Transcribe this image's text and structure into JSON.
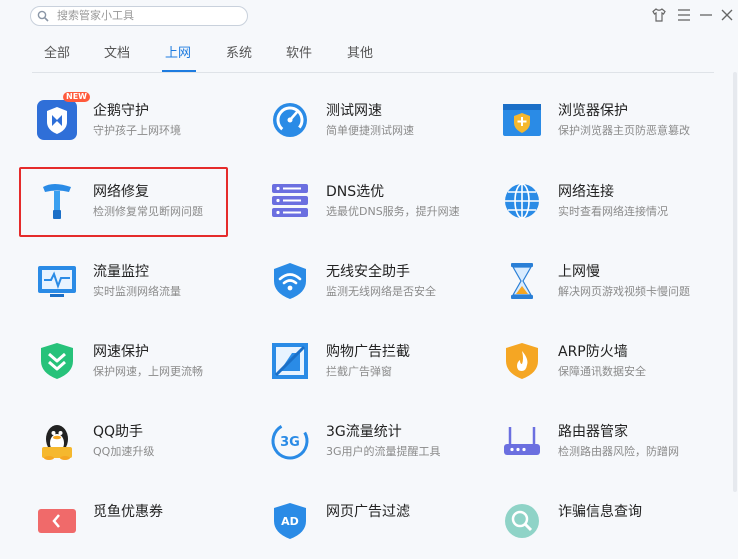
{
  "search": {
    "placeholder": "搜索管家小工具"
  },
  "tabs": [
    {
      "label": "全部"
    },
    {
      "label": "文档"
    },
    {
      "label": "上网"
    },
    {
      "label": "系统"
    },
    {
      "label": "软件"
    },
    {
      "label": "其他"
    }
  ],
  "active_tab": "上网",
  "tools": [
    {
      "title": "企鹅守护",
      "desc": "守护孩子上网环境",
      "badge": "NEW",
      "icon": "penguin-shield-icon"
    },
    {
      "title": "测试网速",
      "desc": "简单便捷测试网速",
      "icon": "speedometer-icon"
    },
    {
      "title": "浏览器保护",
      "desc": "保护浏览器主页防恶意篡改",
      "icon": "browser-shield-icon"
    },
    {
      "title": "网络修复",
      "desc": "检测修复常见断网问题",
      "icon": "hammer-icon"
    },
    {
      "title": "DNS选优",
      "desc": "选最优DNS服务，提升网速",
      "icon": "server-icon"
    },
    {
      "title": "网络连接",
      "desc": "实时查看网络连接情况",
      "icon": "globe-icon"
    },
    {
      "title": "流量监控",
      "desc": "实时监测网络流量",
      "icon": "monitor-icon"
    },
    {
      "title": "无线安全助手",
      "desc": "监测无线网络是否安全",
      "icon": "wifi-shield-icon"
    },
    {
      "title": "上网慢",
      "desc": "解决网页游戏视频卡慢问题",
      "icon": "hourglass-icon"
    },
    {
      "title": "网速保护",
      "desc": "保护网速，上网更流畅",
      "icon": "chevron-shield-icon"
    },
    {
      "title": "购物广告拦截",
      "desc": "拦截广告弹窗",
      "icon": "ad-block-icon"
    },
    {
      "title": "ARP防火墙",
      "desc": "保障通讯数据安全",
      "icon": "firewall-icon"
    },
    {
      "title": "QQ助手",
      "desc": "QQ加速升级",
      "icon": "qq-penguin-icon"
    },
    {
      "title": "3G流量统计",
      "desc": "3G用户的流量提醒工具",
      "icon": "3g-icon"
    },
    {
      "title": "路由器管家",
      "desc": "检测路由器风险，防蹭网",
      "icon": "router-icon"
    },
    {
      "title": "觅鱼优惠券",
      "desc": "",
      "icon": "coupon-icon"
    },
    {
      "title": "网页广告过滤",
      "desc": "",
      "icon": "ad-filter-icon"
    },
    {
      "title": "诈骗信息查询",
      "desc": "",
      "icon": "fraud-query-icon"
    }
  ],
  "icon_labels": {
    "3g": "3G",
    "ad": "AD"
  },
  "colors": {
    "accent": "#1e7ce0",
    "highlight": "#e52b2b",
    "background": "#f6f8fb"
  }
}
